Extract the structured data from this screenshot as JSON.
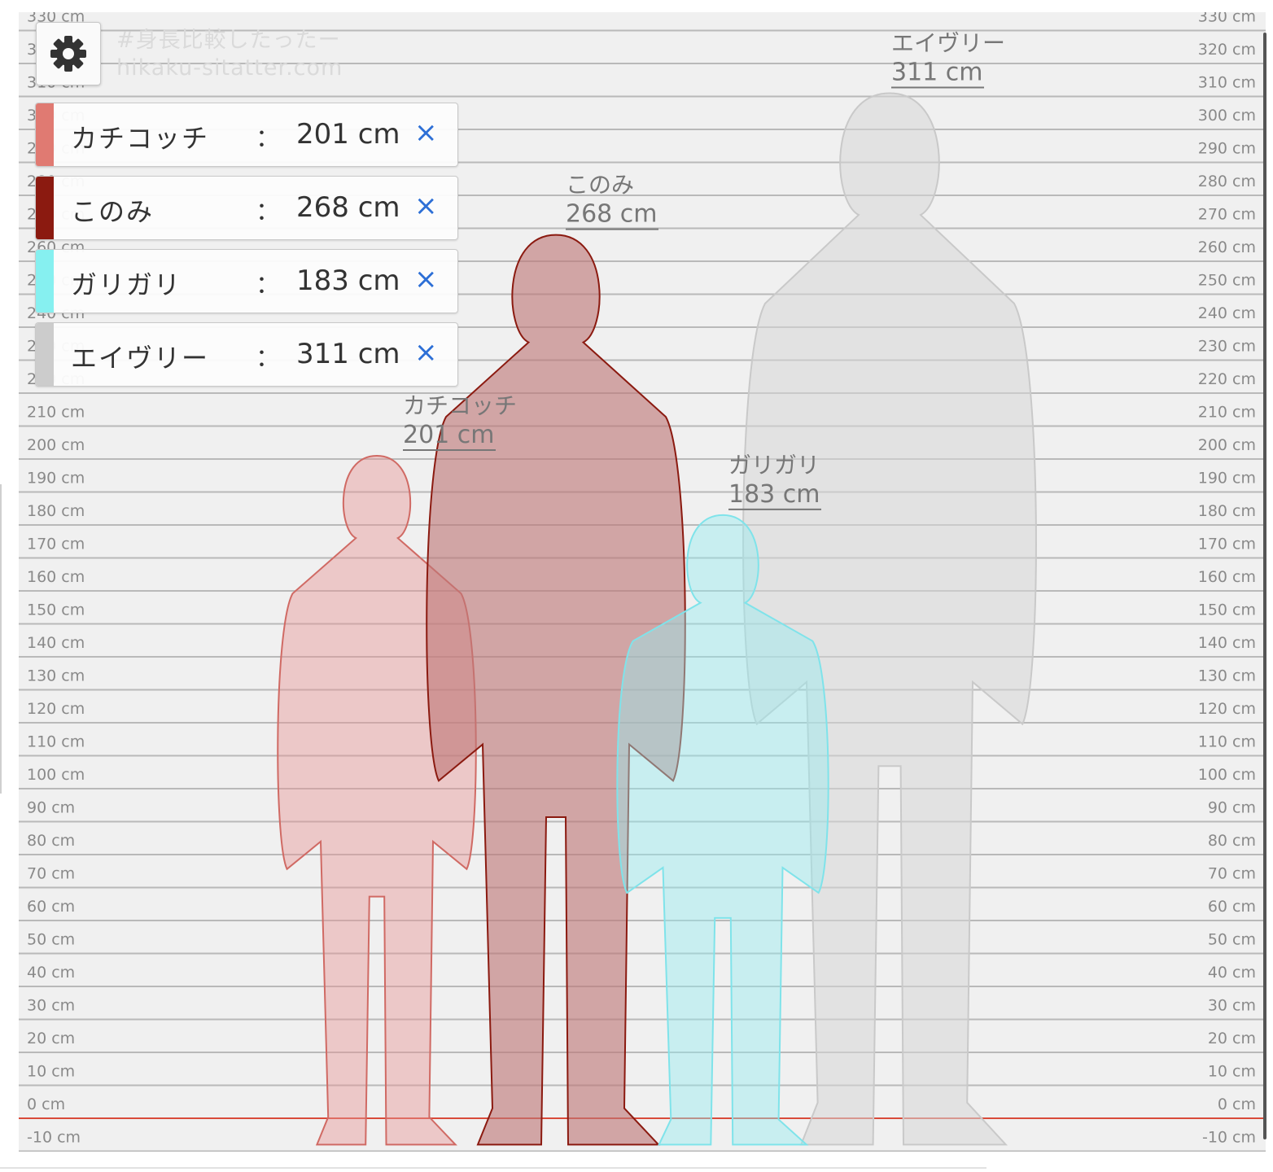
{
  "site": {
    "title": "#身長比較したったー",
    "url": "hikaku-sitatter.com"
  },
  "axis": {
    "unit": "cm",
    "min": -10,
    "max": 330,
    "step": 10,
    "baseline": 0,
    "baseline_color": "#d94a3a"
  },
  "figures": [
    {
      "name": "カチコッチ",
      "height_label": "201 cm",
      "height": 201,
      "color": "#e07a72",
      "fill": "rgba(230,150,150,0.45)",
      "stroke": "#d06a64"
    },
    {
      "name": "このみ",
      "height_label": "268 cm",
      "height": 268,
      "color": "#8b1a10",
      "fill": "rgba(190,120,120,0.62)",
      "stroke": "#8b1a10"
    },
    {
      "name": "ガリガリ",
      "height_label": "183 cm",
      "height": 183,
      "color": "#86f0f0",
      "fill": "rgba(150,235,240,0.45)",
      "stroke": "#7fe3ea"
    },
    {
      "name": "エイヴリー",
      "height_label": "311 cm",
      "height": 311,
      "color": "#cccccc",
      "fill": "rgba(215,215,215,0.55)",
      "stroke": "#c9c9c9"
    }
  ],
  "legend": {
    "separator": "：",
    "remove_glyph": "×"
  },
  "icons": {
    "settings": "gear-icon",
    "remove": "close-icon"
  }
}
